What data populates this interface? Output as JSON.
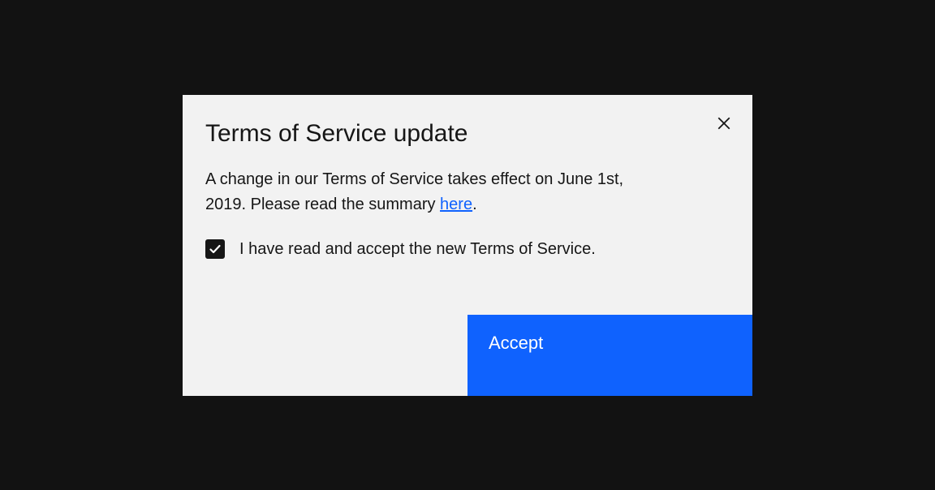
{
  "modal": {
    "title": "Terms of Service update",
    "description_pre": "A change in our Terms of Service takes effect on June 1st, 2019. Please read the summary ",
    "description_link": "here",
    "description_post": ".",
    "checkbox": {
      "checked": true,
      "label": "I have read and accept the new Terms of Service."
    },
    "accept_label": "Accept"
  }
}
